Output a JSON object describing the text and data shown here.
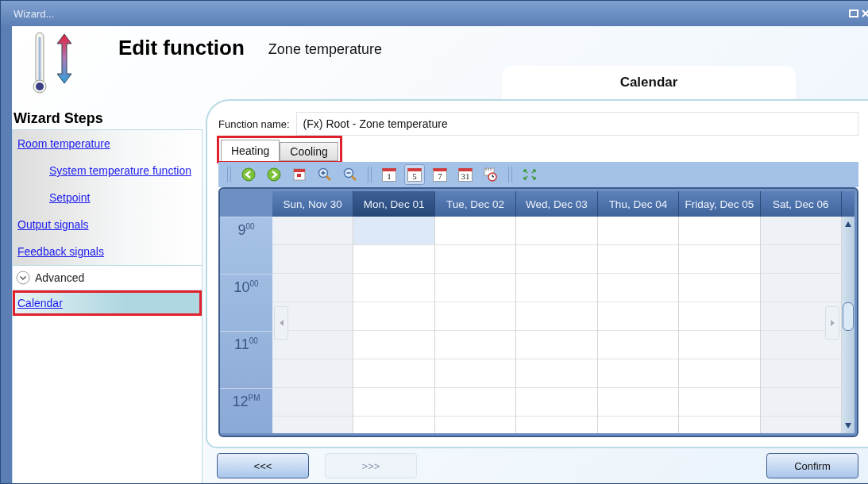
{
  "window": {
    "title": "Wizard..."
  },
  "header": {
    "title": "Edit function",
    "subtitle": "Zone temperature",
    "page_tab": "Calendar"
  },
  "sidebar": {
    "title": "Wizard Steps",
    "items": [
      {
        "label": "Room temperature",
        "kind": "link",
        "selected": false,
        "highlighted": false,
        "children": [
          {
            "label": "System temperature function",
            "kind": "link",
            "selected": false,
            "highlighted": false
          },
          {
            "label": "Setpoint",
            "kind": "link",
            "selected": false,
            "highlighted": false
          }
        ]
      },
      {
        "label": "Output signals",
        "kind": "link",
        "selected": false,
        "highlighted": false
      },
      {
        "label": "Feedback signals",
        "kind": "link",
        "selected": false,
        "highlighted": false
      },
      {
        "label": "Advanced",
        "kind": "section"
      },
      {
        "label": "Calendar",
        "kind": "link",
        "selected": true,
        "highlighted": true
      }
    ]
  },
  "function_name": {
    "label": "Function name:",
    "value": "(Fx) Root - Zone temperature"
  },
  "mode_tabs": {
    "highlighted": true,
    "tabs": [
      {
        "label": "Heating",
        "selected": true
      },
      {
        "label": "Cooling",
        "selected": false
      }
    ]
  },
  "toolbar": [
    {
      "kind": "back",
      "selected": false
    },
    {
      "kind": "forward",
      "selected": false
    },
    {
      "kind": "today",
      "selected": false
    },
    {
      "kind": "zoom_in",
      "selected": false
    },
    {
      "kind": "zoom_out",
      "selected": false
    },
    {
      "kind": "separator"
    },
    {
      "kind": "view",
      "label": "1",
      "selected": false
    },
    {
      "kind": "view",
      "label": "5",
      "selected": true
    },
    {
      "kind": "view",
      "label": "7",
      "selected": false
    },
    {
      "kind": "view",
      "label": "31",
      "selected": false
    },
    {
      "kind": "timeline",
      "selected": false
    },
    {
      "kind": "separator"
    },
    {
      "kind": "fit",
      "selected": false
    }
  ],
  "calendar": {
    "days": [
      {
        "label": "Sun, Nov 30",
        "selected": false,
        "weekend": true
      },
      {
        "label": "Mon, Dec 01",
        "selected": true,
        "weekend": false
      },
      {
        "label": "Tue, Dec 02",
        "selected": false,
        "weekend": false
      },
      {
        "label": "Wed, Dec 03",
        "selected": false,
        "weekend": false
      },
      {
        "label": "Thu, Dec 04",
        "selected": false,
        "weekend": false
      },
      {
        "label": "Friday, Dec 05",
        "selected": false,
        "weekend": false
      },
      {
        "label": "Sat, Dec 06",
        "selected": false,
        "weekend": true
      }
    ],
    "hours": [
      "9$^{00}$",
      "10$^{00}$",
      "11$^{00}$",
      "12$^{PM}$"
    ]
  },
  "buttons": [
    {
      "label": "<<<",
      "disabled": false
    },
    {
      "label": ">>>",
      "disabled": true
    },
    {
      "label": "Confirm",
      "disabled": false
    }
  ]
}
